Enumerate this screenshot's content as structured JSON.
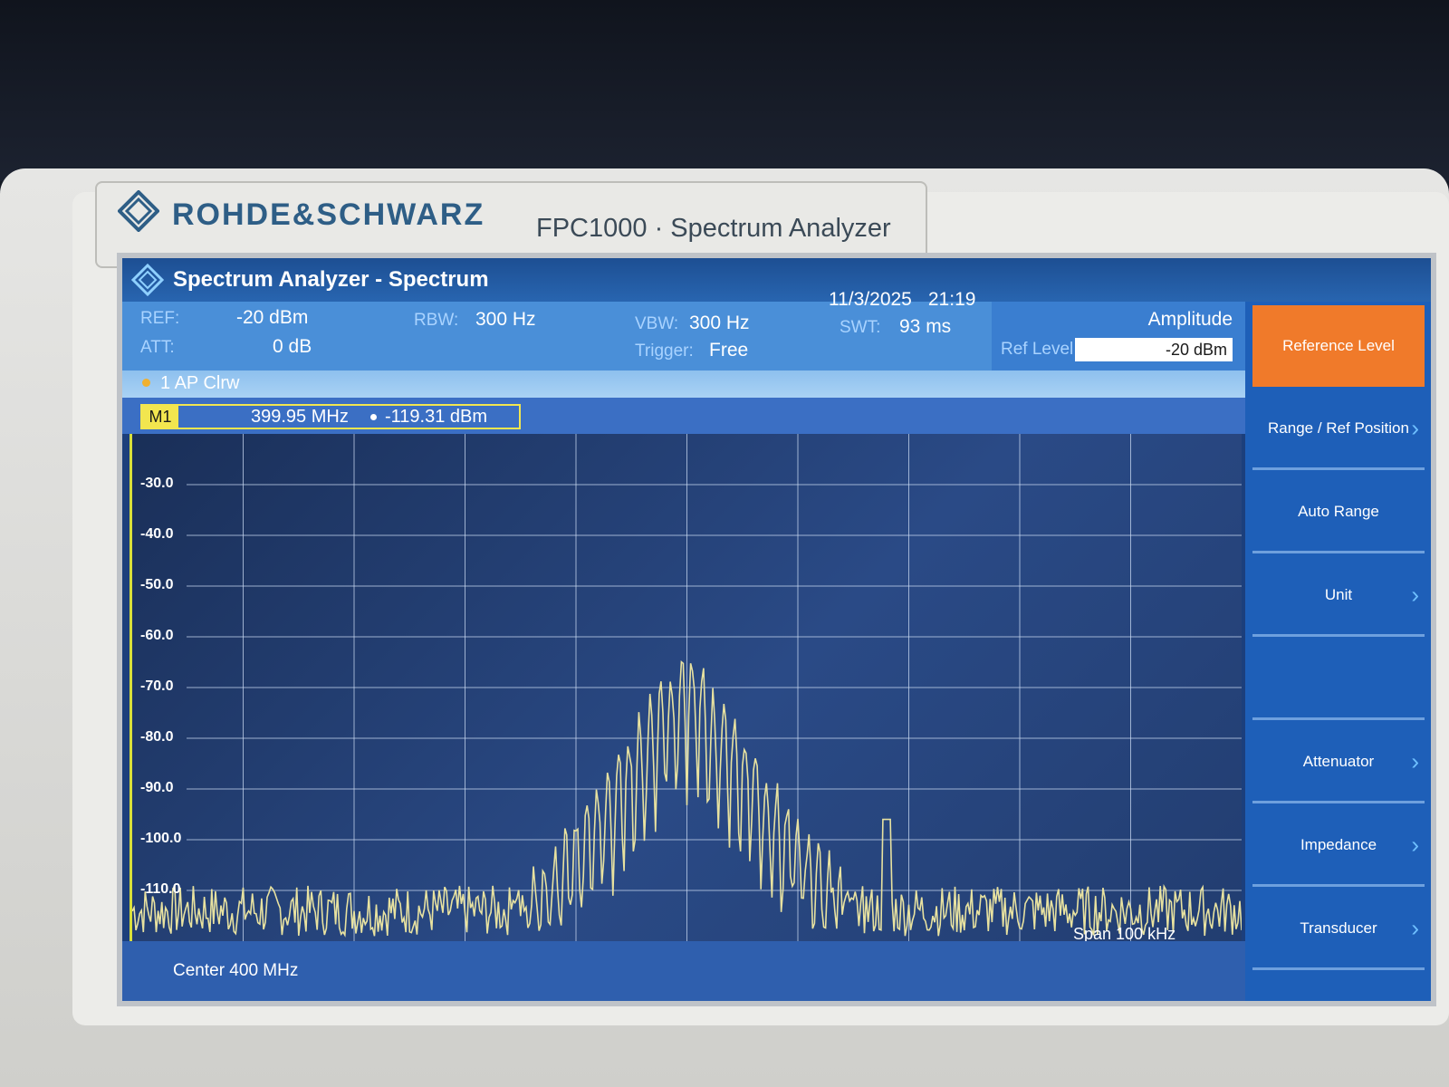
{
  "device": {
    "brand": "ROHDE&SCHWARZ",
    "model": "FPC1000 · Spectrum Analyzer"
  },
  "window": {
    "title": "Spectrum Analyzer - Spectrum",
    "date": "11/3/2025",
    "time": "21:19"
  },
  "settings": {
    "ref_label": "REF:",
    "ref_value": "-20 dBm",
    "att_label": "ATT:",
    "att_value": "0 dB",
    "rbw_label": "RBW:",
    "rbw_value": "300 Hz",
    "vbw_label": "VBW:",
    "vbw_value": "300 Hz",
    "trigger_label": "Trigger:",
    "trigger_value": "Free",
    "swt_label": "SWT:",
    "swt_value": "93 ms"
  },
  "trace": {
    "label": "1 AP Clrw"
  },
  "marker": {
    "tag": "M1",
    "frequency": "399.95 MHz",
    "level": "-119.31 dBm"
  },
  "amplitude_panel": {
    "title": "Amplitude",
    "ref_level_label": "Ref Level",
    "ref_level_value": "-20 dBm"
  },
  "softkeys": [
    {
      "label": "Reference Level",
      "active": true,
      "chevron": false
    },
    {
      "label": "Range / Ref Position",
      "active": false,
      "chevron": true
    },
    {
      "label": "Auto Range",
      "active": false,
      "chevron": false
    },
    {
      "label": "Unit",
      "active": false,
      "chevron": true
    },
    {
      "label": "",
      "active": false,
      "chevron": false
    },
    {
      "label": "Attenuator",
      "active": false,
      "chevron": true
    },
    {
      "label": "Impedance",
      "active": false,
      "chevron": true
    },
    {
      "label": "Transducer",
      "active": false,
      "chevron": true
    }
  ],
  "plot": {
    "center_label": "Center 400 MHz",
    "span_label": "Span 100 kHz",
    "y_ticks": [
      "-30.0",
      "-40.0",
      "-50.0",
      "-60.0",
      "-70.0",
      "-80.0",
      "-90.0",
      "-100.0",
      "-110.0"
    ],
    "ref_level_dbm": -20,
    "bottom_dbm": -120,
    "trace_color": "#e8e2a0",
    "noise_floor_dbm": -114,
    "peak": {
      "freq_offset_khz": 0,
      "level_dbm": -60.5
    },
    "spur": {
      "freq_offset_khz": 18,
      "level_dbm": -96
    }
  }
}
